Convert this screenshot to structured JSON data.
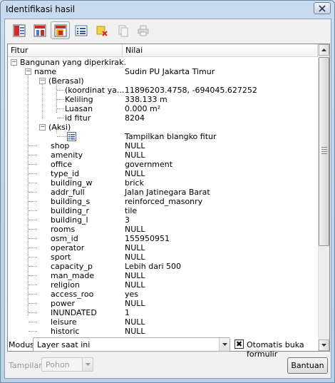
{
  "window": {
    "title": "Identifikasi hasil"
  },
  "toolbar": {
    "buttons": [
      {
        "name": "expand-tree-button",
        "icon": "expand-icon",
        "active": false
      },
      {
        "name": "collapse-tree-button",
        "icon": "collapse-icon",
        "active": false
      },
      {
        "name": "expand-new-results-button",
        "icon": "expand-new-icon",
        "active": true
      },
      {
        "name": "open-form-button",
        "icon": "form-icon",
        "active": false
      },
      {
        "name": "clear-results-button",
        "icon": "clear-icon",
        "active": false
      },
      {
        "name": "copy-button",
        "icon": "copy-icon",
        "active": false
      },
      {
        "name": "print-button",
        "icon": "print-icon",
        "active": false
      }
    ]
  },
  "table": {
    "col_feature": "Fitur",
    "col_value": "Nilai",
    "layer": "Bangunan yang diperkirak...",
    "name_key": "name",
    "name_value": "Sudin PU Jakarta Timur",
    "derived_label": "(Berasal)",
    "derived": [
      {
        "k": "(koordinat ya...",
        "v": "11896203.4758, -694045.627252"
      },
      {
        "k": "Keliling",
        "v": "338.133 m"
      },
      {
        "k": "Luasan",
        "v": "0.000 m²"
      },
      {
        "k": "id fitur",
        "v": "8204"
      }
    ],
    "actions_label": "(Aksi)",
    "action_value": "Tampilkan blangko fitur",
    "attributes": [
      {
        "k": "shop",
        "v": "NULL"
      },
      {
        "k": "amenity",
        "v": "NULL"
      },
      {
        "k": "office",
        "v": "government"
      },
      {
        "k": "type_id",
        "v": "NULL"
      },
      {
        "k": "building_w",
        "v": "brick"
      },
      {
        "k": "addr_full",
        "v": "Jalan Jatinegara Barat"
      },
      {
        "k": "building_s",
        "v": "reinforced_masonry"
      },
      {
        "k": "building_r",
        "v": "tile"
      },
      {
        "k": "building_l",
        "v": "3"
      },
      {
        "k": "rooms",
        "v": "NULL"
      },
      {
        "k": "osm_id",
        "v": "155950951"
      },
      {
        "k": "operator",
        "v": "NULL"
      },
      {
        "k": "sport",
        "v": "NULL"
      },
      {
        "k": "capacity_p",
        "v": "Lebih dari 500"
      },
      {
        "k": "man_made",
        "v": "NULL"
      },
      {
        "k": "religion",
        "v": "NULL"
      },
      {
        "k": "access_roo",
        "v": "yes"
      },
      {
        "k": "power",
        "v": "NULL"
      },
      {
        "k": "INUNDATED",
        "v": "1"
      },
      {
        "k": "leisure",
        "v": "NULL"
      },
      {
        "k": "historic",
        "v": "NULL"
      }
    ]
  },
  "footer": {
    "mode_label": "Modus",
    "mode_value": "Layer saat ini",
    "auto_open_label": "Otomatis buka formulir",
    "auto_open_checked": true,
    "view_label": "Tampilan",
    "view_value": "Pohon",
    "help_button": "Bantuan"
  },
  "colors": {
    "title_bg": "#c9dbee",
    "tree_bg": "#ffffff",
    "panel_bg": "#f0f0f0"
  }
}
